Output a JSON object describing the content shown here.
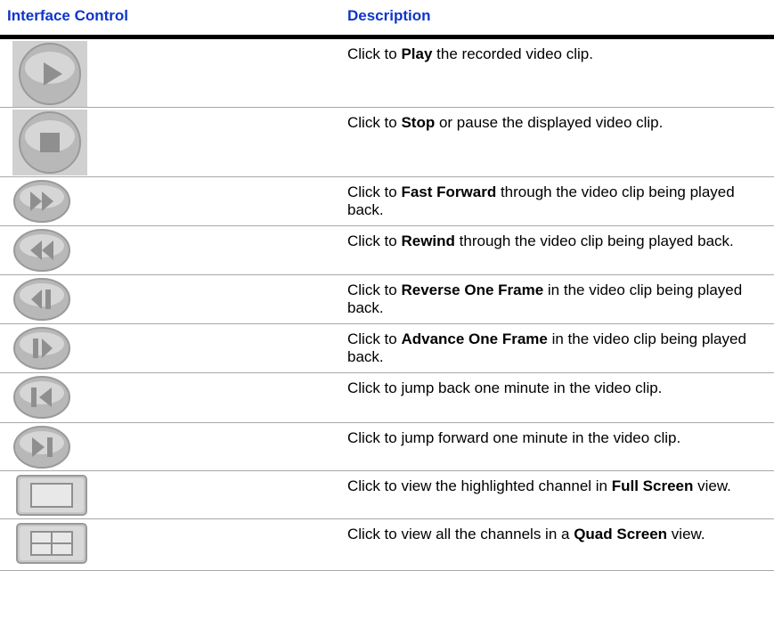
{
  "header": {
    "col1": "Interface Control",
    "col2": "Description"
  },
  "rows": [
    {
      "icon": "play-icon",
      "pre": "Click to ",
      "bold": "Play",
      "post": " the recorded video clip."
    },
    {
      "icon": "stop-icon",
      "pre": "Click to ",
      "bold": "Stop",
      "post": " or pause the displayed video clip."
    },
    {
      "icon": "fast-forward-icon",
      "pre": "Click to ",
      "bold": "Fast Forward",
      "post": " through the video clip being played back."
    },
    {
      "icon": "rewind-icon",
      "pre": "Click to ",
      "bold": "Rewind",
      "post": " through the video clip being played back."
    },
    {
      "icon": "reverse-frame-icon",
      "pre": "Click to ",
      "bold": "Reverse One Frame",
      "post": " in the video clip being played back."
    },
    {
      "icon": "advance-frame-icon",
      "pre": "Click to ",
      "bold": "Advance One Frame",
      "post": " in the video clip being played back."
    },
    {
      "icon": "skip-back-icon",
      "pre": "Click to jump back one minute in the video clip.",
      "bold": "",
      "post": ""
    },
    {
      "icon": "skip-forward-icon",
      "pre": "Click to jump forward one minute in the video clip.",
      "bold": "",
      "post": ""
    },
    {
      "icon": "full-screen-icon",
      "pre": "Click to view the highlighted channel in ",
      "bold": "Full Screen",
      "post": " view."
    },
    {
      "icon": "quad-screen-icon",
      "pre": "Click to view all the channels in a ",
      "bold": "Quad Screen",
      "post": " view."
    }
  ]
}
